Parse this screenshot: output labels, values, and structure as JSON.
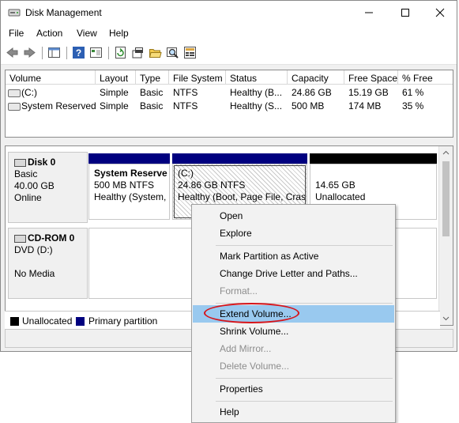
{
  "window": {
    "title": "Disk Management"
  },
  "menu": [
    "File",
    "Action",
    "View",
    "Help"
  ],
  "volume_list": {
    "columns": [
      "Volume",
      "Layout",
      "Type",
      "File System",
      "Status",
      "Capacity",
      "Free Space",
      "% Free"
    ],
    "rows": [
      [
        "(C:)",
        "Simple",
        "Basic",
        "NTFS",
        "Healthy (B...",
        "24.86 GB",
        "15.19 GB",
        "61 %"
      ],
      [
        "System Reserved",
        "Simple",
        "Basic",
        "NTFS",
        "Healthy (S...",
        "500 MB",
        "174 MB",
        "35 %"
      ]
    ]
  },
  "disks": [
    {
      "name": "Disk 0",
      "lines": [
        "Basic",
        "40.00 GB",
        "Online"
      ]
    },
    {
      "name": "CD-ROM 0",
      "lines": [
        "DVD (D:)",
        "",
        "No Media"
      ]
    }
  ],
  "partitions": [
    {
      "name": "System Reserve",
      "size": "500 MB NTFS",
      "status": "Healthy (System,",
      "bar_color": "#00007f"
    },
    {
      "name": "(C:)",
      "size": "24.86 GB NTFS",
      "status": "Healthy (Boot, Page File, Crasl",
      "bar_color": "#00007f"
    },
    {
      "name": "",
      "size": "14.65 GB",
      "status": "Unallocated",
      "bar_color": "#000000"
    }
  ],
  "legend": [
    {
      "label": "Unallocated",
      "color": "#000000"
    },
    {
      "label": "Primary partition",
      "color": "#00007f"
    }
  ],
  "context_menu": {
    "items": [
      {
        "label": "Open",
        "enabled": true
      },
      {
        "label": "Explore",
        "enabled": true
      },
      {
        "label": "Mark Partition as Active",
        "enabled": true
      },
      {
        "label": "Change Drive Letter and Paths...",
        "enabled": true
      },
      {
        "label": "Format...",
        "enabled": false
      },
      {
        "label": "Extend Volume...",
        "enabled": true,
        "highlighted": true
      },
      {
        "label": "Shrink Volume...",
        "enabled": true
      },
      {
        "label": "Add Mirror...",
        "enabled": false
      },
      {
        "label": "Delete Volume...",
        "enabled": false
      },
      {
        "label": "Properties",
        "enabled": true
      },
      {
        "label": "Help",
        "enabled": true
      }
    ]
  },
  "colors": {
    "highlight": "#99c9ef",
    "annotation": "#d6141a"
  }
}
